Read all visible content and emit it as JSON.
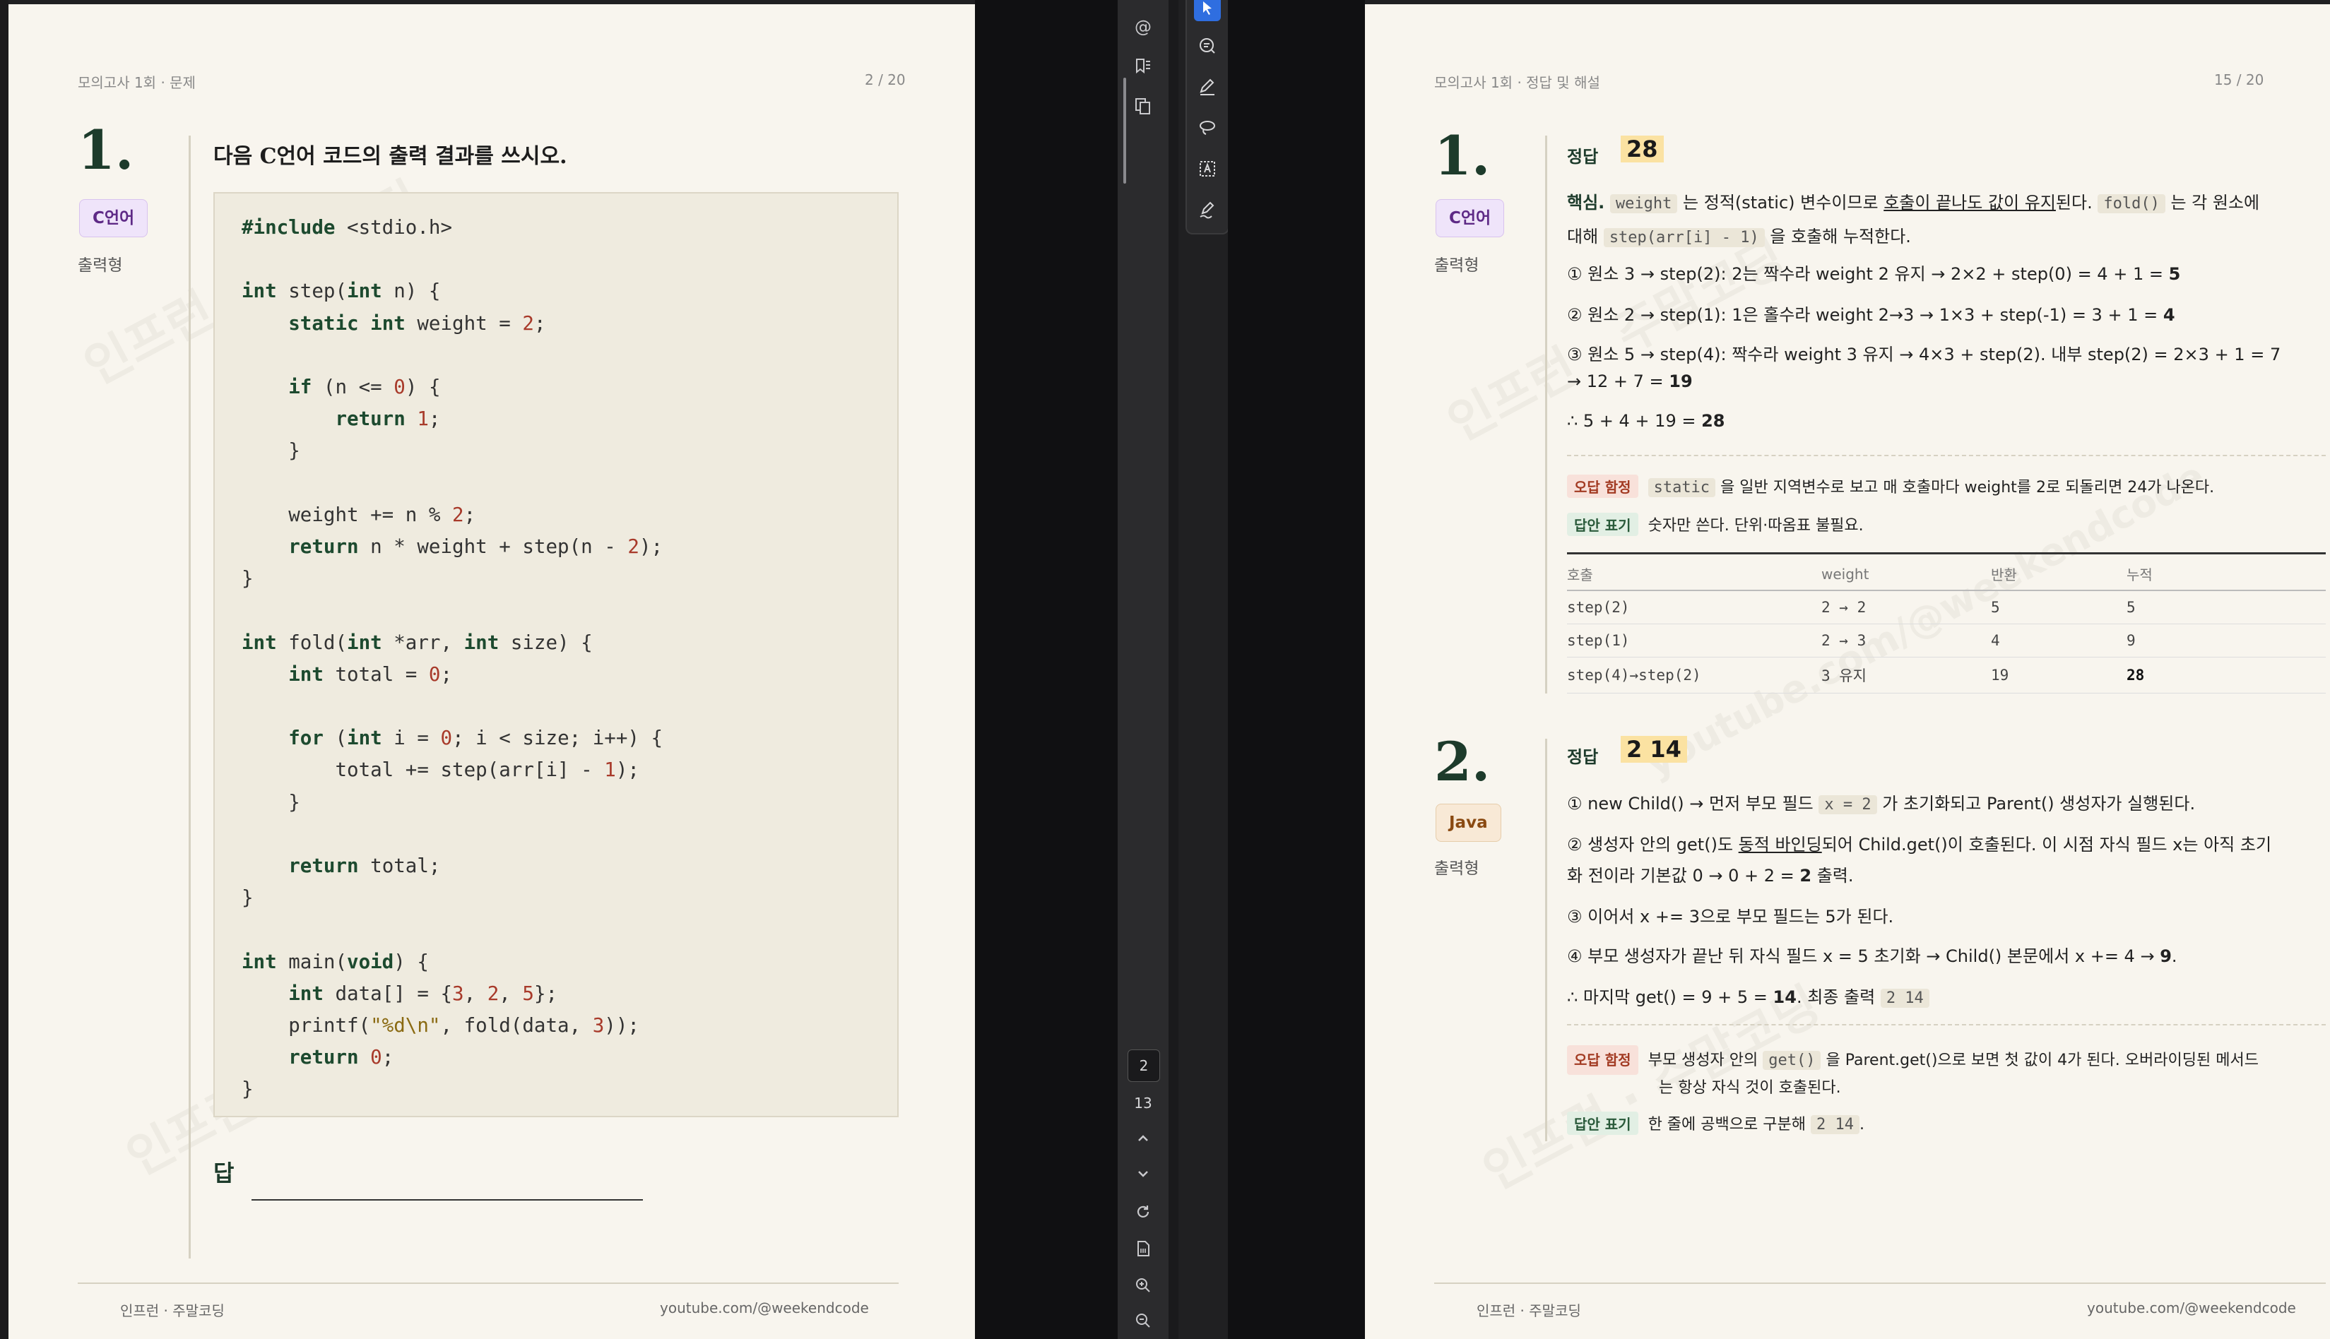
{
  "left_page": {
    "header_left": "모의고사 1회 · 문제",
    "header_right": "2 / 20",
    "qnum": "1.",
    "tag": "C언어",
    "qtype": "출력형",
    "question": "다음 C언어 코드의 출력 결과를 쓰시오.",
    "answer_label": "답",
    "footer_left": "인프런 · 주말코딩",
    "footer_right": "youtube.com/@weekendcode"
  },
  "toolbar_icons": [
    "select-cursor-icon",
    "comment-icon",
    "pen-icon",
    "lasso-icon",
    "text-select-icon",
    "sign-icon"
  ],
  "sidebar": {
    "icons": [
      "at-icon",
      "bookmark-list-icon",
      "copy-pages-icon"
    ],
    "current_page": "2",
    "next_page": "13"
  },
  "right_page": {
    "header_left": "모의고사 1회 · 정답 및 해설",
    "header_right": "15 / 20",
    "q1": {
      "qnum": "1.",
      "tag": "C언어",
      "qtype": "출력형",
      "label": "정답",
      "answer": "28",
      "core_label": "핵심.",
      "core_code1": "weight",
      "core_text1": "는 정적(static) 변수이므로",
      "core_underline": "호출이 끝나도 값이 유지",
      "core_text2": "된다.",
      "core_code2": "fold()",
      "core_text3": "는 각 원소에",
      "core_text4": "대해",
      "core_code3": "step(arr[i] - 1)",
      "core_text5": "을 호출해 누적한다.",
      "step1_text": "① 원소 3 → step(2): 2는 짝수라 weight 2 유지 → 2×2 + step(0) = 4 + 1 = ",
      "step1_result": "5",
      "step2_text": "② 원소 2 → step(1): 1은 홀수라 weight 2→3 → 1×3 + step(-1) = 3 + 1 = ",
      "step2_result": "4",
      "step3_text": "③ 원소 5 → step(4): 짝수라 weight 3 유지 → 4×3 + step(2). 내부 step(2) = 2×3 + 1 = 7",
      "step3_cont": "→ 12 + 7 = ",
      "step3_result": "19",
      "sum_text": "∴ 5 + 4 + 19 = ",
      "sum_result": "28",
      "trap_label": "오답 함정",
      "trap_code": "static",
      "trap_text": "을 일반 지역변수로 보고 매 호출마다 weight를 2로 되돌리면 24가 나온다.",
      "mark_label": "답안 표기",
      "mark_text": "숫자만 쓴다. 단위·따옴표 불필요.",
      "table": {
        "headers": [
          "호출",
          "weight",
          "반환",
          "누적"
        ],
        "rows": [
          [
            "step(2)",
            "2 → 2",
            "5",
            "5"
          ],
          [
            "step(1)",
            "2 → 3",
            "4",
            "9"
          ],
          [
            "step(4)→step(2)",
            "3 유지",
            "19",
            "28"
          ]
        ]
      }
    },
    "q2": {
      "qnum": "2.",
      "tag": "Java",
      "qtype": "출력형",
      "label": "정답",
      "answer": "2 14",
      "s1_a": "① new Child() → 먼저 부모 필드",
      "s1_code": "x = 2",
      "s1_b": "가 초기화되고 Parent() 생성자가 실행된다.",
      "s2_a": "② 생성자 안의 get()도",
      "s2_underline": "동적 바인딩",
      "s2_b": "되어 Child.get()이 호출된다. 이 시점 자식 필드 x는 아직 초기",
      "s2_c": "화 전이라 기본값 0 → 0 + 2 = ",
      "s2_bold": "2",
      "s2_d": " 출력.",
      "s3": "③ 이어서 x += 3으로 부모 필드는 5가 된다.",
      "s4_a": "④ 부모 생성자가 끝난 뒤 자식 필드 x = 5 초기화 → Child() 본문에서 x += 4 → ",
      "s4_bold": "9",
      "s4_b": ".",
      "s5_a": "∴ 마지막 get() = 9 + 5 = ",
      "s5_bold": "14",
      "s5_b": ". 최종 출력",
      "s5_code": "2 14",
      "trap_label": "오답 함정",
      "trap_a": "부모 생성자 안의",
      "trap_code": "get()",
      "trap_b": "을 Parent.get()으로 보면 첫 값이 4가 된다. 오버라이딩된 메서드",
      "trap_c": "는 항상 자식 것이 호출된다.",
      "mark_label": "답안 표기",
      "mark_a": "한 줄에 공백으로 구분해",
      "mark_code": "2 14",
      "mark_b": "."
    },
    "footer_left": "인프런 · 주말코딩",
    "footer_right": "youtube.com/@weekendcode"
  },
  "watermark": "인프런 · 주말코딩",
  "watermark2": "youtube.com/@weekendcode"
}
